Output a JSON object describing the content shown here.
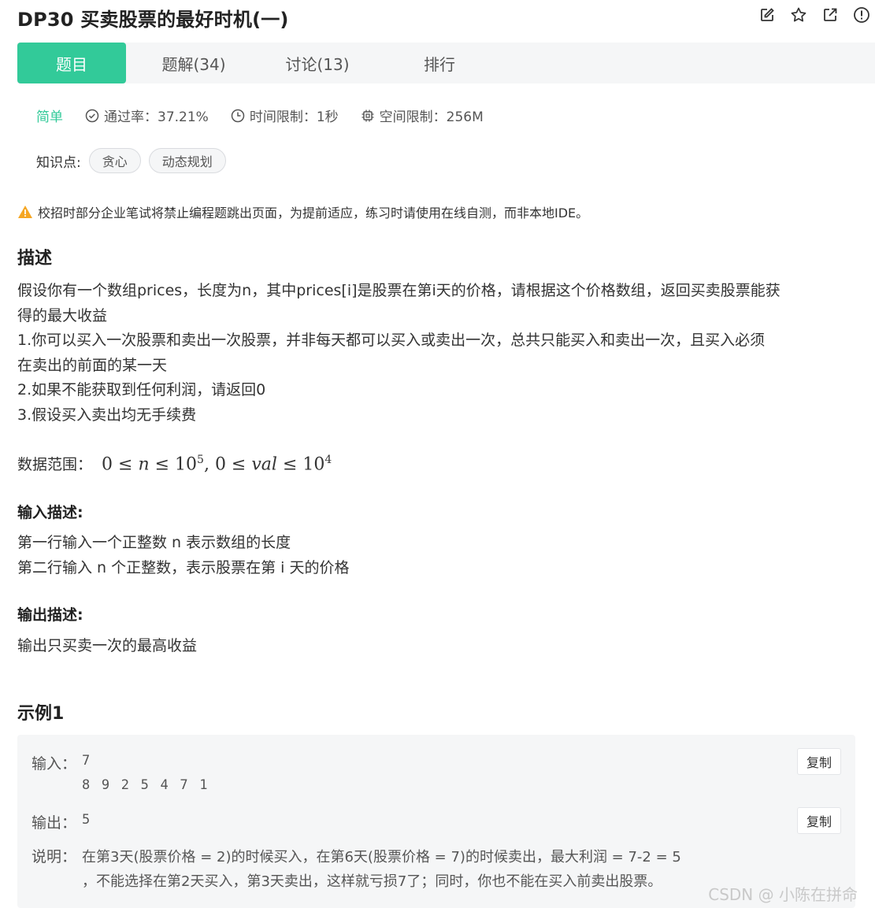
{
  "header": {
    "title": "DP30  买卖股票的最好时机(一)",
    "icons": [
      "edit-icon",
      "star-icon",
      "share-icon",
      "report-icon"
    ]
  },
  "tabs": [
    {
      "label": "题目",
      "active": true
    },
    {
      "label": "题解(34)",
      "active": false
    },
    {
      "label": "讨论(13)",
      "active": false
    },
    {
      "label": "排行",
      "active": false
    }
  ],
  "meta": {
    "difficulty": "简单",
    "pass_rate": "通过率：37.21%",
    "time_limit": "时间限制：1秒",
    "memory_limit": "空间限制：256M"
  },
  "knowledge": {
    "label": "知识点:",
    "tags": [
      "贪心",
      "动态规划"
    ]
  },
  "warning": "校招时部分企业笔试将禁止编程题跳出页面，为提前适应，练习时请使用在线自测，而非本地IDE。",
  "description": {
    "heading": "描述",
    "lines": [
      "假设你有一个数组prices，长度为n，其中prices[i]是股票在第i天的价格，请根据这个价格数组，返回买卖股票能获",
      "得的最大收益",
      "1.你可以买入一次股票和卖出一次股票，并非每天都可以买入或卖出一次，总共只能买入和卖出一次，且买入必须",
      "在卖出的前面的某一天",
      "2.如果不能获取到任何利润，请返回0",
      "3.假设买入卖出均无手续费"
    ],
    "range_label": "数据范围：",
    "range_math": {
      "a": "0 ≤ ",
      "n": "n",
      "b": " ≤ 10",
      "exp1": "5",
      "c": ", 0 ≤ ",
      "val": "val",
      "d": " ≤ 10",
      "exp2": "4"
    }
  },
  "input_desc": {
    "heading": "输入描述:",
    "lines": [
      "第一行输入一个正整数 n 表示数组的长度",
      "第二行输入 n 个正整数，表示股票在第 i 天的价格"
    ]
  },
  "output_desc": {
    "heading": "输出描述:",
    "lines": [
      "输出只买卖一次的最高收益"
    ]
  },
  "example": {
    "heading": "示例1",
    "input_label": "输入：",
    "input_lines": [
      "7",
      "8 9 2 5 4 7 1"
    ],
    "output_label": "输出：",
    "output_value": "5",
    "copy_label": "复制",
    "explain_label": "说明：",
    "explain_lines": [
      "在第3天(股票价格 = 2)的时候买入，在第6天(股票价格 = 7)的时候卖出，最大利润 = 7-2 = 5",
      "，不能选择在第2天买入，第3天卖出，这样就亏损7了；同时，你也不能在买入前卖出股票。"
    ]
  },
  "watermark": "CSDN @ 小陈在拼命",
  "colors": {
    "accent": "#32ca99",
    "warning": "#f5a623",
    "tab_bg": "#f5f6f7"
  }
}
